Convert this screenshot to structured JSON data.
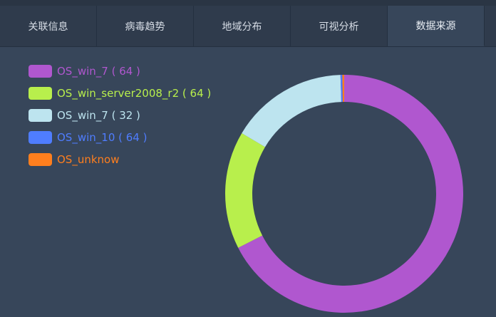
{
  "tabs": [
    {
      "label": "关联信息",
      "active": false
    },
    {
      "label": "病毒趋势",
      "active": false
    },
    {
      "label": "地域分布",
      "active": false
    },
    {
      "label": "可视分析",
      "active": false
    },
    {
      "label": "数据来源",
      "active": true
    }
  ],
  "chart_data": {
    "type": "pie",
    "style": "donut",
    "legend_position": "top-left",
    "series": [
      {
        "name": "OS_win_7",
        "label": "OS_win_7 ( 64 )",
        "value": 64,
        "color": "#b057cf"
      },
      {
        "name": "OS_win_server2008_r2",
        "label": "OS_win_server2008_r2 ( 64 )",
        "value": 64,
        "color": "#b8ef4c"
      },
      {
        "name": "OS_win_7",
        "label": "OS_win_7 ( 32 )",
        "value": 32,
        "color": "#bde4ef"
      },
      {
        "name": "OS_win_10",
        "label": "OS_win_10 ( 64 )",
        "value": 64,
        "color": "#4f7dff"
      },
      {
        "name": "OS_unknow",
        "label": "OS_unknow",
        "value": null,
        "color": "#ff7f1e"
      }
    ],
    "slice_fractions": [
      0.675,
      0.16,
      0.16,
      0.0025,
      0.0025
    ]
  }
}
